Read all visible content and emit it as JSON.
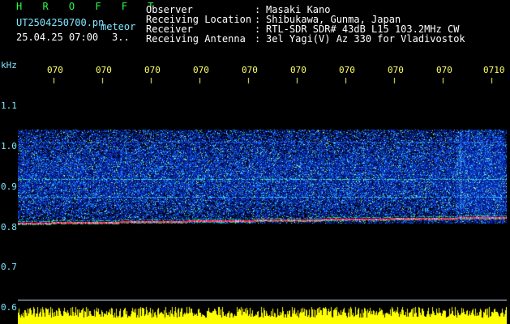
{
  "header": {
    "app_name": "H R O F F T",
    "filename": "UT2504250700.pn",
    "mode": "meteor",
    "date_time": "25.04.25 07:00",
    "count": "3..",
    "labels": [
      "Observer",
      "Receiving Location",
      "Receiver",
      "Receiving Antenna"
    ],
    "separators": [
      ":",
      ":",
      ":",
      ":"
    ],
    "values": [
      "Masaki Kano",
      "Shibukawa, Gunma, Japan",
      "RTL-SDR SDR# 43dB L15 103.2MHz CW",
      "3el Yagi(V) Az 330 for Vladivostok"
    ]
  },
  "axis": {
    "unit": "kHz",
    "y_ticks": [
      "1.1",
      "1.0",
      "0.9",
      "0.8",
      "0.7",
      "0.6"
    ],
    "x_ticks": [
      "070",
      "070",
      "070",
      "070",
      "070",
      "070",
      "070",
      "070",
      "070",
      "0710"
    ]
  },
  "colors": {
    "label": "#7fe6ff",
    "tick": "#ffff66",
    "title": "#29ff4a",
    "echo": "#ff2d55",
    "noise": "#0a2a9a"
  }
}
